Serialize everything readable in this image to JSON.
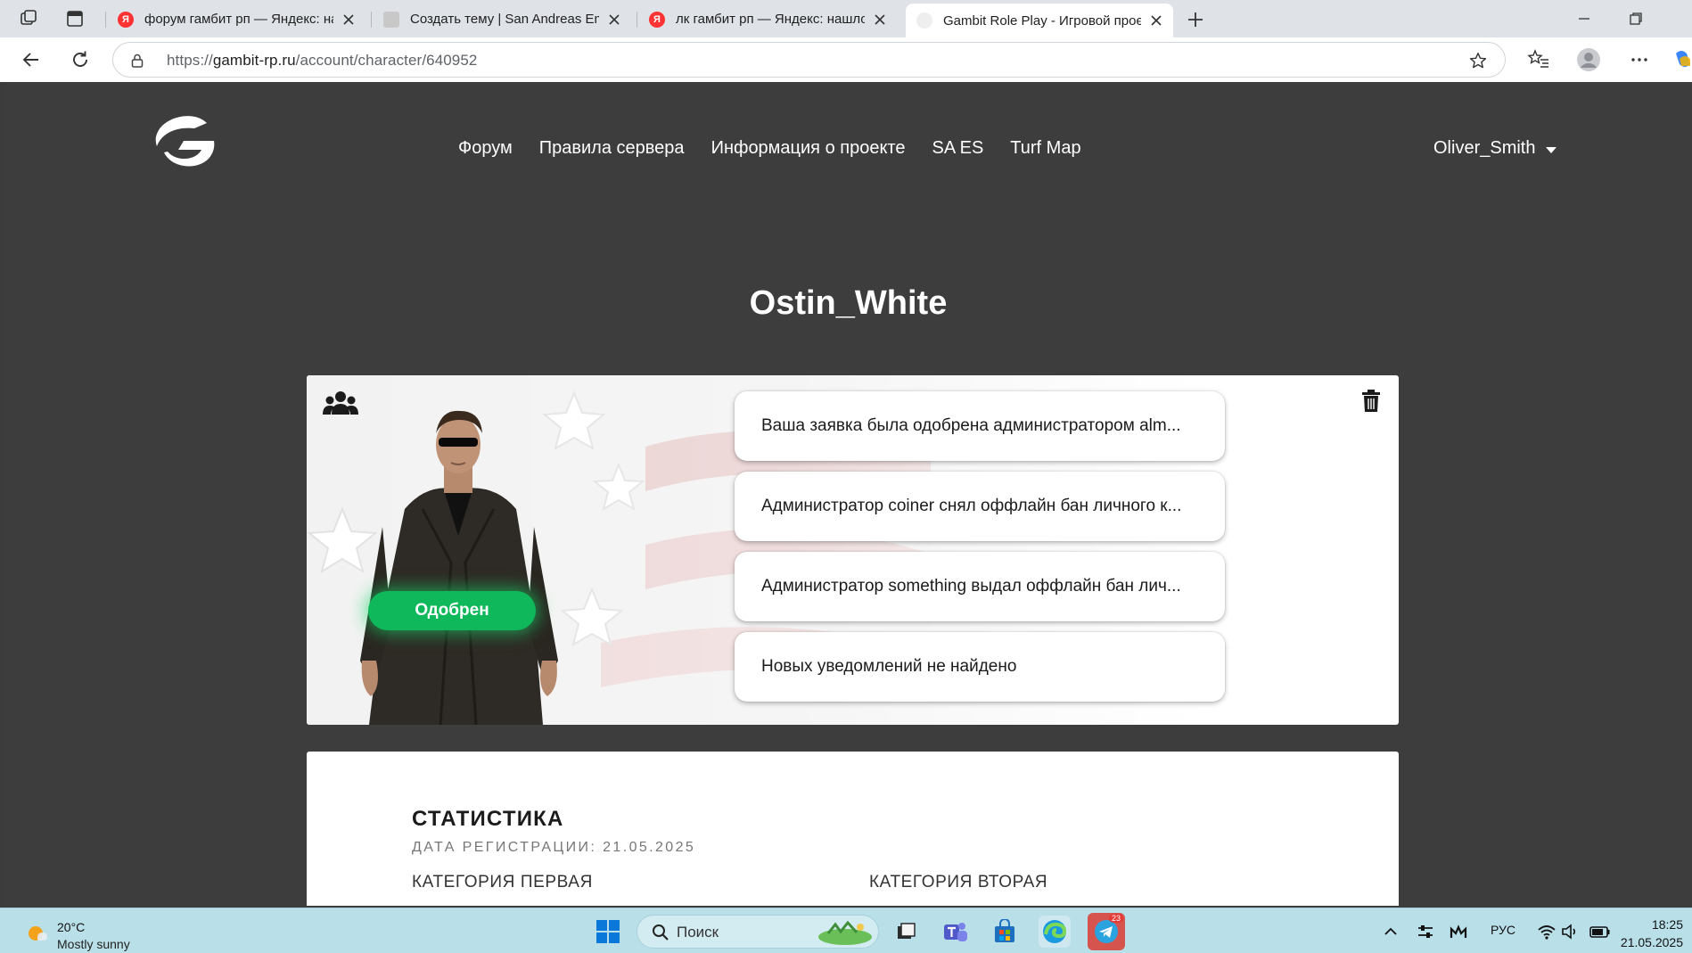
{
  "browser": {
    "tabs": [
      {
        "title": "форум гамбит рп — Яндекс: наш",
        "favicon": "yandex-icon",
        "active": false
      },
      {
        "title": "Создать тему | San Andreas Emer",
        "favicon": "forum-icon",
        "active": false
      },
      {
        "title": "лк гамбит рп — Яндекс: нашлос",
        "favicon": "yandex-icon",
        "active": false
      },
      {
        "title": "Gambit Role Play - Игровой проє",
        "favicon": "gambit-icon",
        "active": true
      }
    ],
    "url_prefix": "https://",
    "url_domain": "gambit-rp.ru",
    "url_path": "/account/character/640952"
  },
  "site": {
    "nav": [
      "Форум",
      "Правила сервера",
      "Информация о проекте",
      "SA ES",
      "Turf Map"
    ],
    "username": "Oliver_Smith",
    "character_name": "Ostin_White",
    "status_label": "Одобрен",
    "notifications": [
      "Ваша заявка была одобрена администратором alm...",
      "Администратор coiner снял оффлайн бан личного к...",
      "Администратор something выдал оффлайн бан лич...",
      "Новых уведомлений не найдено"
    ],
    "stats": {
      "title": "СТАТИСТИКА",
      "registration": "ДАТА РЕГИСТРАЦИИ: 21.05.2025",
      "category_first": "КАТЕГОРИЯ ПЕРВАЯ",
      "category_second": "КАТЕГОРИЯ ВТОРАЯ"
    }
  },
  "taskbar": {
    "weather_temp": "20°C",
    "weather_desc": "Mostly sunny",
    "search_placeholder": "Поиск",
    "language": "РУС",
    "time": "18:25",
    "date": "21.05.2025",
    "telegram_badge": "23"
  },
  "colors": {
    "page_bg": "#3d3d3d",
    "approved_green": "#0fb85b",
    "tab_strip": "#dfe3e8",
    "taskbar": "#b9dfe8"
  }
}
